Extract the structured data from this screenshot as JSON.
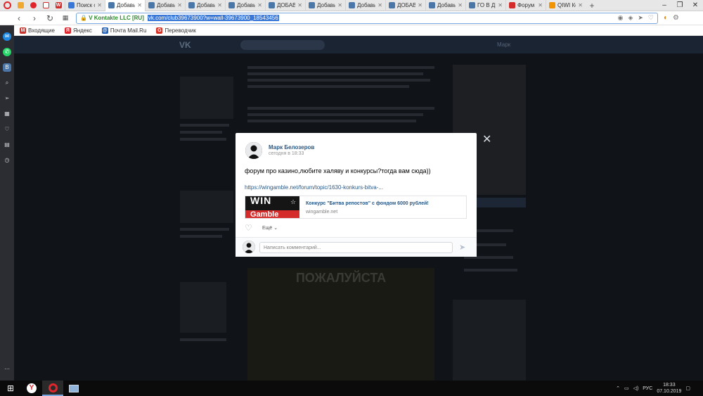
{
  "browser": {
    "tabs": [
      {
        "label": "Поиск с",
        "color": "#3a78d8"
      },
      {
        "label": "Добавь в",
        "color": "#4a76a8",
        "active": true
      },
      {
        "label": "Добавь в",
        "color": "#4a76a8"
      },
      {
        "label": "Добавь в",
        "color": "#4a76a8"
      },
      {
        "label": "Добавь в",
        "color": "#4a76a8"
      },
      {
        "label": "ДОБАВЬ",
        "color": "#4a76a8"
      },
      {
        "label": "Добавь в",
        "color": "#4a76a8"
      },
      {
        "label": "Добавь в",
        "color": "#4a76a8"
      },
      {
        "label": "ДОБАВЬ",
        "color": "#4a76a8"
      },
      {
        "label": "Добавь в",
        "color": "#4a76a8"
      },
      {
        "label": "ГО В ДР",
        "color": "#4a76a8"
      },
      {
        "label": "Форум",
        "color": "#d42b2b"
      },
      {
        "label": "QIWI Ко",
        "color": "#f29400"
      }
    ],
    "security_label": "V Kontakte LLC [RU]",
    "url": "vk.com/club39673900?w=wall-39673900_18543456",
    "bookmarks": [
      {
        "label": "Входящие",
        "color": "#c8332b",
        "icon": "M"
      },
      {
        "label": "Яндекс",
        "color": "#e0262c",
        "icon": "Я"
      },
      {
        "label": "Почта Mail.Ru",
        "color": "#1e5fb8",
        "icon": "@"
      },
      {
        "label": "Переводчик",
        "color": "#d93025",
        "icon": "G"
      }
    ]
  },
  "vk": {
    "header_user": "Марк",
    "post": {
      "author": "Марк Белозеров",
      "time": "сегодня в 18:33",
      "text": "форум про казино,любите халяву и конкурсы?тогда вам сюда))",
      "link": "https://wingamble.net/forum/topic/1630-konkurs-bitva-...",
      "card_image_text_1": "WIN",
      "card_image_text_2": "Gamble",
      "card_title": "Конкурс \"Битва репостов\" с фондом 6000 рублей!",
      "card_site": "wingamble.net",
      "more_label": "Ещё",
      "comment_placeholder": "Написать комментарий..."
    },
    "background": {
      "meme_text": "ПОЖАЛУЙСТА"
    }
  },
  "taskbar": {
    "lang": "РУС",
    "time": "18:33",
    "date": "07.10.2019"
  }
}
